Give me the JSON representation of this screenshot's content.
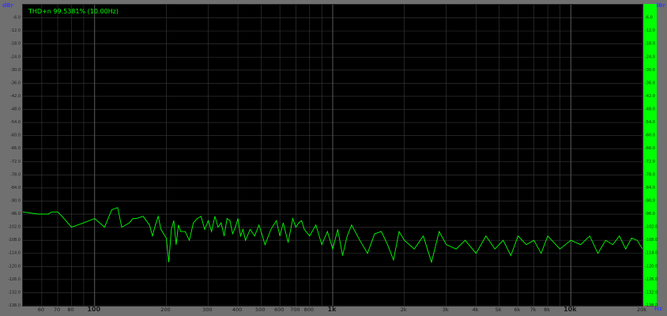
{
  "readout": "THD+n 99.5381% (10.00Hz)",
  "units": {
    "left": "dBr",
    "right": "dBr",
    "freq": "Hz"
  },
  "colors": {
    "trace": "#00ff00",
    "grid": "#3a3a3a",
    "background": "#000000",
    "frame": "#707070",
    "unit": "#3a3aff"
  },
  "chart_data": {
    "type": "line",
    "title": "THD+n 99.5381% (10.00Hz)",
    "xlabel": "Hz",
    "ylabel": "dBr",
    "xscale": "log",
    "xlim": [
      50,
      20000
    ],
    "ylim": [
      -138,
      0
    ],
    "grid": true,
    "y_ticks": [
      "-6.0",
      "-12.0",
      "-18.0",
      "-24.0",
      "-30.0",
      "-36.0",
      "-42.0",
      "-48.0",
      "-54.0",
      "-60.0",
      "-66.0",
      "-72.0",
      "-78.0",
      "-84.0",
      "-90.0",
      "-96.0",
      "-102.0",
      "-108.0",
      "-114.0",
      "-120.0",
      "-126.0",
      "-132.0",
      "-138.0"
    ],
    "y_tick_values": [
      -6,
      -12,
      -18,
      -24,
      -30,
      -36,
      -42,
      -48,
      -54,
      -60,
      -66,
      -72,
      -78,
      -84,
      -90,
      -96,
      -102,
      -108,
      -114,
      -120,
      -126,
      -132,
      -138
    ],
    "x_ticks": [
      {
        "v": 60,
        "label": "60",
        "bold": false
      },
      {
        "v": 70,
        "label": "70",
        "bold": false
      },
      {
        "v": 80,
        "label": "80",
        "bold": false
      },
      {
        "v": 100,
        "label": "100",
        "bold": true
      },
      {
        "v": 200,
        "label": "200",
        "bold": false
      },
      {
        "v": 300,
        "label": "300",
        "bold": false
      },
      {
        "v": 400,
        "label": "400",
        "bold": false
      },
      {
        "v": 500,
        "label": "500",
        "bold": false
      },
      {
        "v": 600,
        "label": "600",
        "bold": false
      },
      {
        "v": 700,
        "label": "700",
        "bold": false
      },
      {
        "v": 800,
        "label": "800",
        "bold": false
      },
      {
        "v": 1000,
        "label": "1k",
        "bold": true
      },
      {
        "v": 2000,
        "label": "2k",
        "bold": false
      },
      {
        "v": 3000,
        "label": "3k",
        "bold": false
      },
      {
        "v": 4000,
        "label": "4k",
        "bold": false
      },
      {
        "v": 5000,
        "label": "5k",
        "bold": false
      },
      {
        "v": 6000,
        "label": "6k",
        "bold": false
      },
      {
        "v": 7000,
        "label": "7k",
        "bold": false
      },
      {
        "v": 8000,
        "label": "8k",
        "bold": false
      },
      {
        "v": 10000,
        "label": "10k",
        "bold": true
      },
      {
        "v": 20000,
        "label": "20k",
        "bold": false
      }
    ],
    "series": [
      {
        "x": [
          50,
          58,
          64,
          66,
          70,
          73,
          80,
          90,
          100,
          105,
          110,
          115,
          118,
          125,
          130,
          140,
          145,
          150,
          160,
          170,
          175,
          180,
          185,
          190,
          200,
          205,
          210,
          215,
          220,
          225,
          230,
          240,
          250,
          260,
          270,
          280,
          290,
          300,
          310,
          320,
          330,
          340,
          350,
          360,
          370,
          380,
          390,
          400,
          410,
          420,
          430,
          450,
          470,
          490,
          500,
          520,
          550,
          580,
          600,
          620,
          650,
          680,
          700,
          720,
          740,
          760,
          800,
          850,
          900,
          950,
          1000,
          1050,
          1100,
          1150,
          1200,
          1300,
          1400,
          1500,
          1600,
          1700,
          1800,
          1900,
          2000,
          2200,
          2400,
          2600,
          2800,
          3000,
          3300,
          3600,
          4000,
          4400,
          4800,
          5200,
          5600,
          6000,
          6500,
          7000,
          7500,
          8000,
          9000,
          10000,
          11000,
          12000,
          13000,
          14000,
          15000,
          16000,
          17000,
          18000,
          19000,
          20000
        ],
        "y": [
          -95,
          -96,
          -96,
          -95,
          -95,
          -97,
          -102,
          -100,
          -98,
          -100,
          -102,
          -97,
          -94,
          -93,
          -102,
          -100,
          -98,
          -98,
          -97,
          -101,
          -106,
          -101,
          -97,
          -103,
          -107,
          -118,
          -103,
          -99,
          -110,
          -101,
          -104,
          -104,
          -108,
          -100,
          -98,
          -97,
          -103,
          -99,
          -104,
          -97,
          -102,
          -100,
          -106,
          -98,
          -99,
          -105,
          -102,
          -98,
          -106,
          -103,
          -108,
          -103,
          -106,
          -101,
          -104,
          -110,
          -103,
          -99,
          -106,
          -100,
          -109,
          -98,
          -102,
          -100,
          -99,
          -103,
          -106,
          -101,
          -110,
          -104,
          -112,
          -103,
          -115,
          -106,
          -101,
          -108,
          -114,
          -105,
          -104,
          -110,
          -117,
          -104,
          -108,
          -112,
          -106,
          -118,
          -104,
          -110,
          -112,
          -108,
          -114,
          -106,
          -112,
          -108,
          -115,
          -106,
          -110,
          -108,
          -114,
          -106,
          -112,
          -108,
          -110,
          -106,
          -114,
          -108,
          -110,
          -106,
          -112,
          -107,
          -108,
          -112
        ]
      }
    ]
  }
}
